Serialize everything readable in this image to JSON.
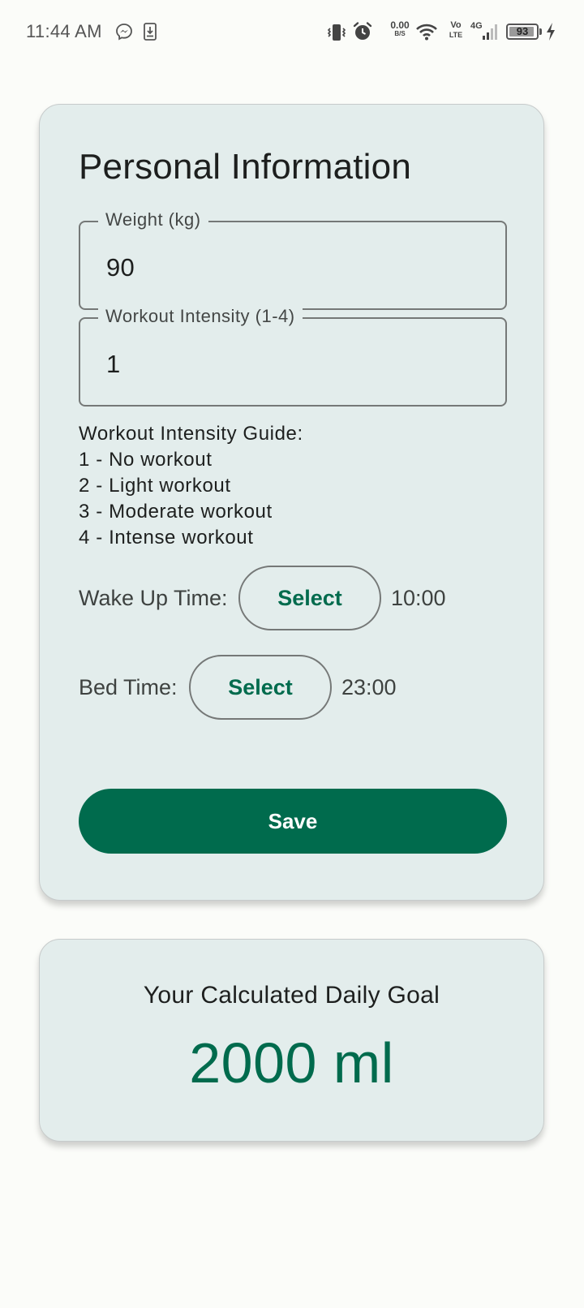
{
  "status_bar": {
    "time": "11:44 AM",
    "net_speed_value": "0.00",
    "net_speed_unit": "B/S",
    "volte_top": "Vo",
    "volte_bottom": "LTE",
    "network_type": "4G",
    "battery_level": "93",
    "battery_fraction": 0.93,
    "icons": [
      "messenger-icon",
      "download-icon",
      "vibrate-icon",
      "alarm-icon",
      "wifi-icon",
      "signal-icon",
      "battery-icon",
      "charging-icon"
    ]
  },
  "personal_info": {
    "title": "Personal Information",
    "weight": {
      "label": "Weight (kg)",
      "value": "90"
    },
    "intensity": {
      "label": "Workout Intensity (1-4)",
      "value": "1"
    },
    "guide": {
      "heading": "Workout Intensity Guide:",
      "items": [
        "1 - No workout",
        "2 - Light workout",
        "3 - Moderate workout",
        "4 - Intense workout"
      ]
    },
    "wake_up": {
      "label": "Wake Up Time:",
      "button": "Select",
      "value": "10:00"
    },
    "bed_time": {
      "label": "Bed Time:",
      "button": "Select",
      "value": "23:00"
    },
    "save_button": "Save"
  },
  "daily_goal": {
    "title": "Your Calculated Daily Goal",
    "value": "2000 ml"
  },
  "colors": {
    "primary": "#006b4d",
    "card_background": "#e3edec",
    "page_background": "#fbfcf9"
  }
}
